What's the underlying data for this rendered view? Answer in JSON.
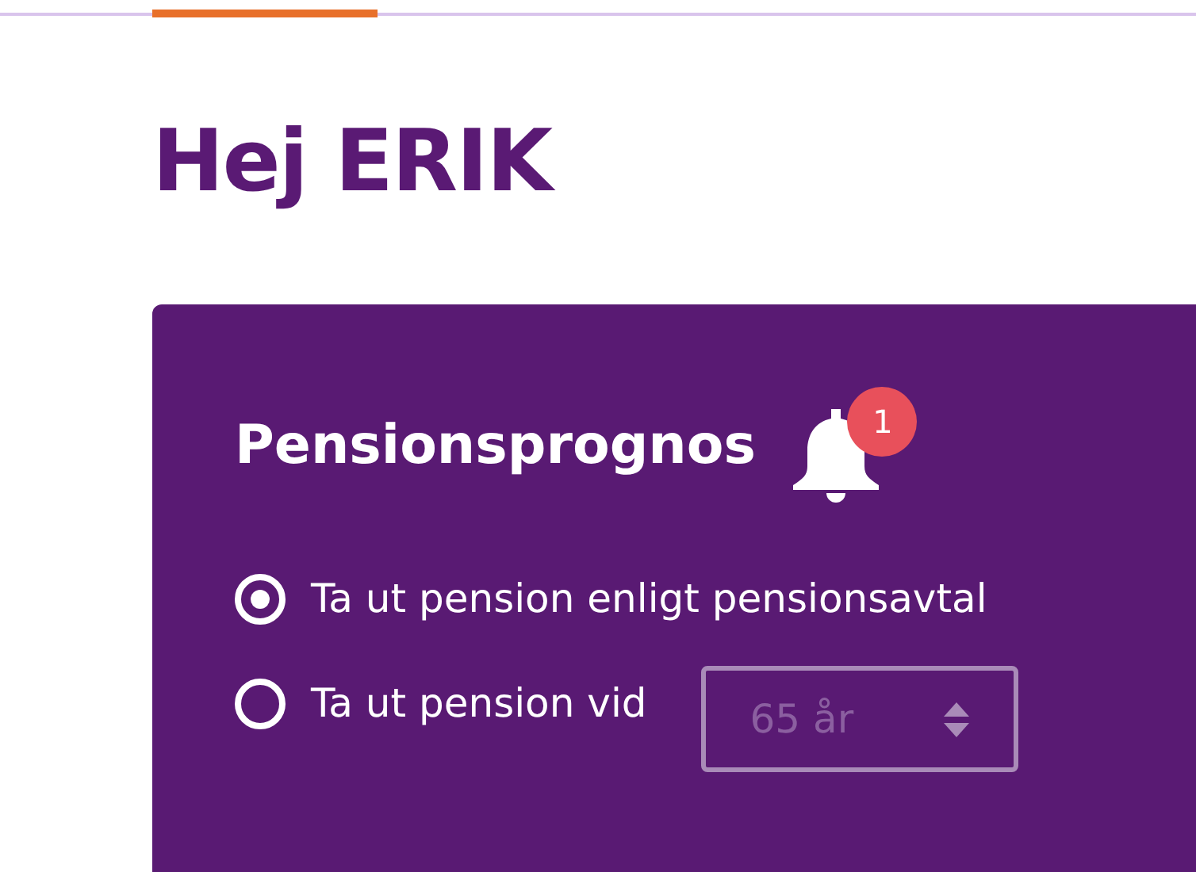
{
  "greeting": "Hej ERIK",
  "card": {
    "title": "Pensionsprognos",
    "notification_count": "1",
    "options": [
      {
        "label": "Ta ut pension enligt pensionsavtal",
        "selected": true
      },
      {
        "label": "Ta ut pension vid",
        "selected": false,
        "select": {
          "value": "65 år",
          "disabled": true
        }
      }
    ]
  }
}
